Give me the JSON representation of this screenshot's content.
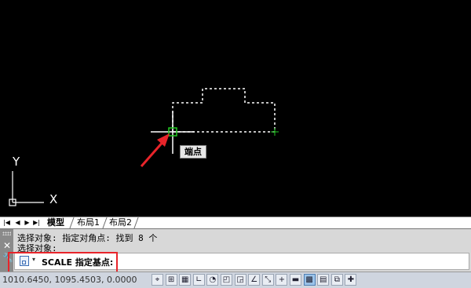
{
  "drawing": {
    "tooltip": "端点",
    "ucs": {
      "y_label": "Y",
      "x_label": "X"
    }
  },
  "layout_tabs": {
    "tabs": [
      {
        "label": "模型",
        "active": true
      },
      {
        "label": "布局1",
        "active": false
      },
      {
        "label": "布局2",
        "active": false
      }
    ]
  },
  "command_window": {
    "history": [
      "选择对象: 指定对角点: 找到 8 个",
      "选择对象:"
    ],
    "prompt": "SCALE 指定基点:"
  },
  "status_bar": {
    "coordinates": "1010.6450, 1095.4503, 0.0000",
    "buttons": [
      {
        "icon": "infer-constraints-icon",
        "on": false
      },
      {
        "icon": "snap-mode-icon",
        "on": false
      },
      {
        "icon": "grid-display-icon",
        "on": false
      },
      {
        "icon": "ortho-mode-icon",
        "on": false
      },
      {
        "icon": "polar-tracking-icon",
        "on": false
      },
      {
        "icon": "object-snap-icon",
        "on": false
      },
      {
        "icon": "3d-object-snap-icon",
        "on": false
      },
      {
        "icon": "object-snap-tracking-icon",
        "on": false
      },
      {
        "icon": "dynamic-ucs-icon",
        "on": false
      },
      {
        "icon": "dynamic-input-icon",
        "on": false
      },
      {
        "icon": "lineweight-icon",
        "on": false
      },
      {
        "icon": "transparency-icon",
        "on": true
      },
      {
        "icon": "quick-properties-icon",
        "on": false
      },
      {
        "icon": "selection-cycling-icon",
        "on": false
      },
      {
        "icon": "annotation-monitor-icon",
        "on": false
      }
    ]
  },
  "colors": {
    "highlight": "#e8242a",
    "arrow": "#e8242a",
    "snap_marker": "#22cc22",
    "crosshair": "#ffffff"
  }
}
